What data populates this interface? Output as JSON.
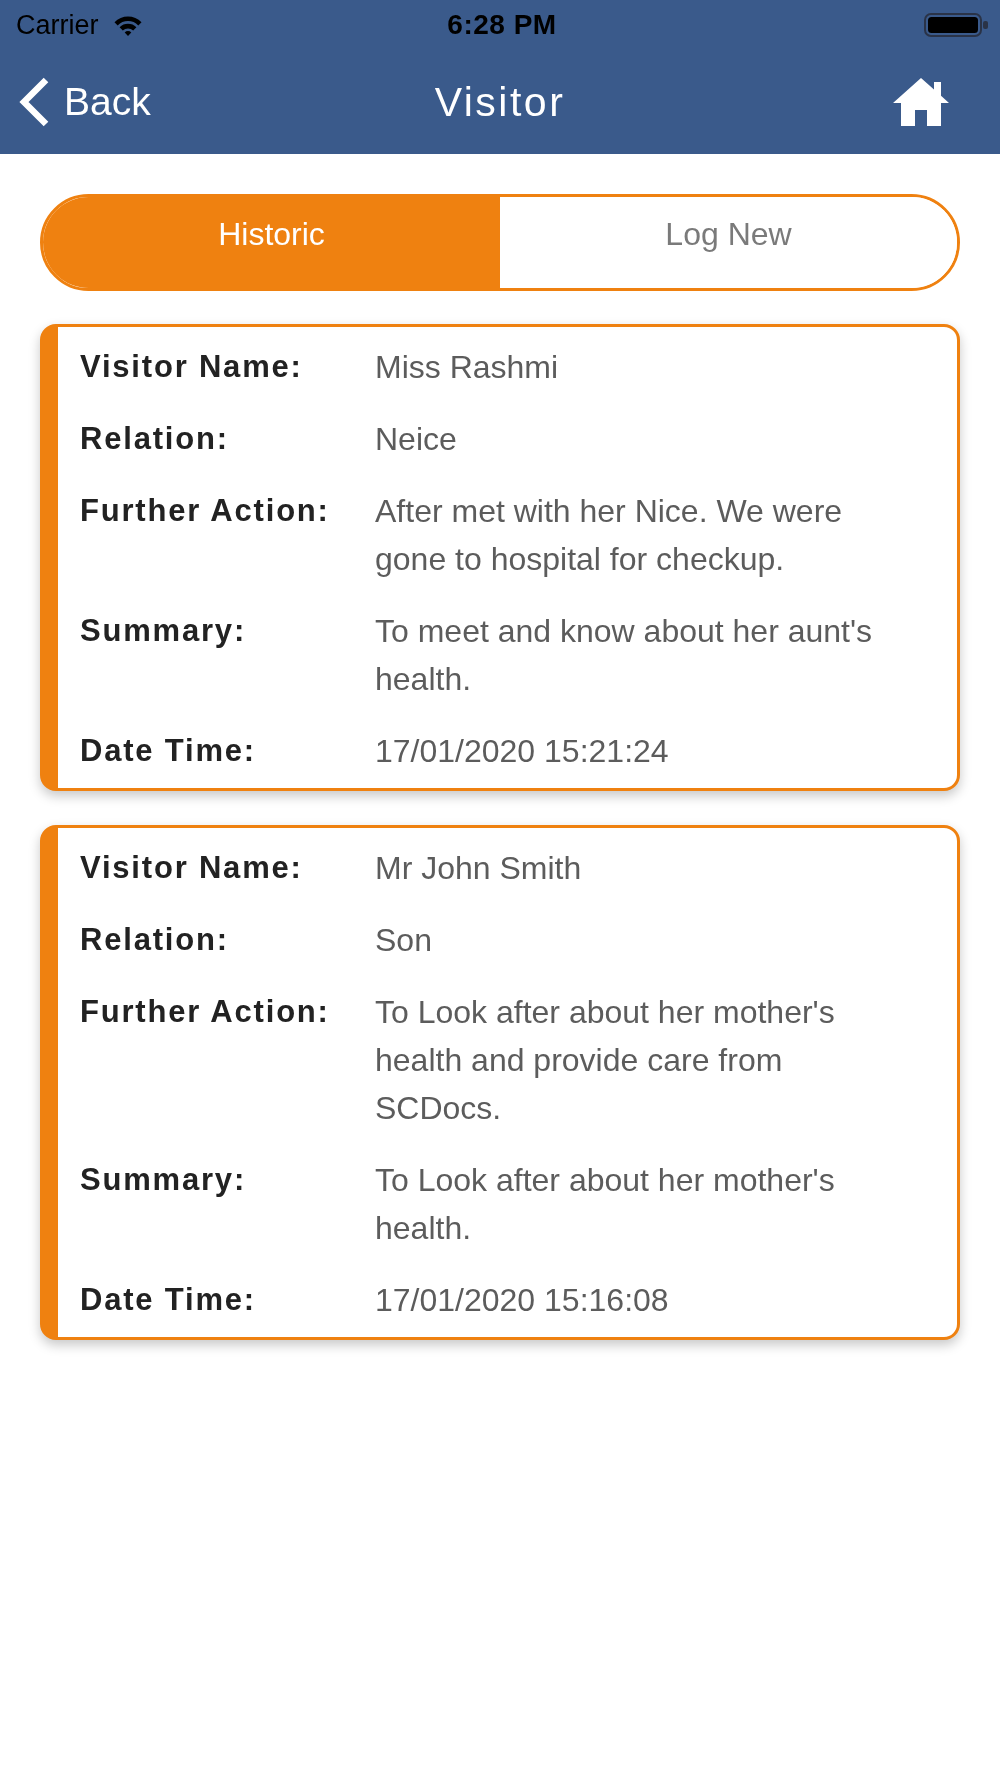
{
  "status_bar": {
    "carrier": "Carrier",
    "time": "6:28 PM"
  },
  "nav_bar": {
    "back_label": "Back",
    "title": "Visitor"
  },
  "tabs": [
    {
      "label": "Historic",
      "selected": true
    },
    {
      "label": "Log New",
      "selected": false
    }
  ],
  "visits": [
    {
      "fields": [
        {
          "label": "Visitor Name:",
          "value": "Miss Rashmi"
        },
        {
          "label": "Relation:",
          "value": "Neice"
        },
        {
          "label": "Further Action:",
          "value": "After met with her Nice. We were gone to hospital for checkup."
        },
        {
          "label": "Summary:",
          "value": "To meet and know about her aunt's health."
        },
        {
          "label": "Date Time:",
          "value": "17/01/2020 15:21:24"
        }
      ]
    },
    {
      "fields": [
        {
          "label": "Visitor Name:",
          "value": "Mr John Smith"
        },
        {
          "label": "Relation:",
          "value": "Son"
        },
        {
          "label": "Further Action:",
          "value": "To Look after about her mother's health and provide care from SCDocs."
        },
        {
          "label": "Summary:",
          "value": "To Look after about her mother's health."
        },
        {
          "label": "Date Time:",
          "value": "17/01/2020 15:16:08"
        }
      ]
    }
  ]
}
